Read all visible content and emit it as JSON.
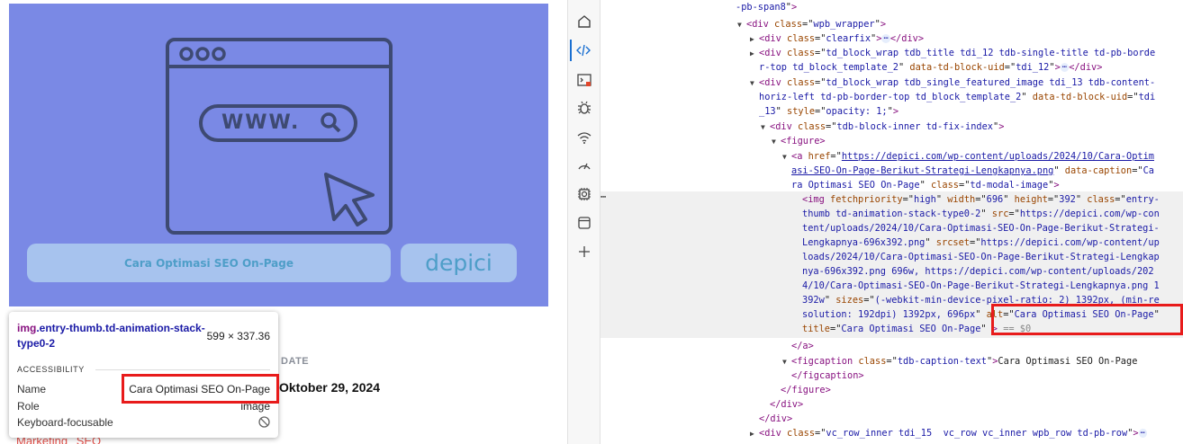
{
  "preview": {
    "hero_caption": "Cara Optimasi SEO On-Page",
    "hero_logo": "depici",
    "hero_url_text": "WWW.",
    "meta_label": "DATE",
    "meta_date": "Oktober 29, 2024",
    "tags": [
      "Marketing",
      "SEO"
    ],
    "hero_bg_color": "#7a89e5"
  },
  "tooltip": {
    "selector_tag": "img",
    "selector_classes": ".entry-thumb.td-animation-stack-type0-2",
    "size": "599 × 337.36",
    "section": "ACCESSIBILITY",
    "rows": [
      {
        "key": "Name",
        "value": "Cara Optimasi SEO On-Page"
      },
      {
        "key": "Role",
        "value": "image"
      },
      {
        "key": "Keyboard-focusable",
        "value": ""
      }
    ]
  },
  "activity_icons": [
    "home-icon",
    "elements-icon",
    "console-icon",
    "sources-bug-icon",
    "network-icon",
    "performance-icon",
    "memory-chip-icon",
    "application-icon",
    "add-tool-icon"
  ],
  "elements": {
    "lines": [
      {
        "indent": 150,
        "text": "-pb-span8\">"
      },
      {
        "indent": 150,
        "html": "<span class='tri'>▼</span><span class='tag'>&lt;div</span> <span class='attr'>class</span>=\"<span class='val'>wpb_wrapper</span>\"<span class='tag'>&gt;</span>"
      },
      {
        "indent": 166,
        "html": "<span class='tri'>▶</span><span class='tag'>&lt;div</span> <span class='attr'>class</span>=\"<span class='val'>clearfix</span>\"<span class='tag'>&gt;</span><span class='dots'>⋯</span><span class='tag'>&lt;/div&gt;</span>"
      }
    ],
    "selected_img_alt": "alt=\"Cara Optimasi SEO On-Page\"",
    "figcaption_text": "Cara Optimasi SEO On-Page"
  }
}
